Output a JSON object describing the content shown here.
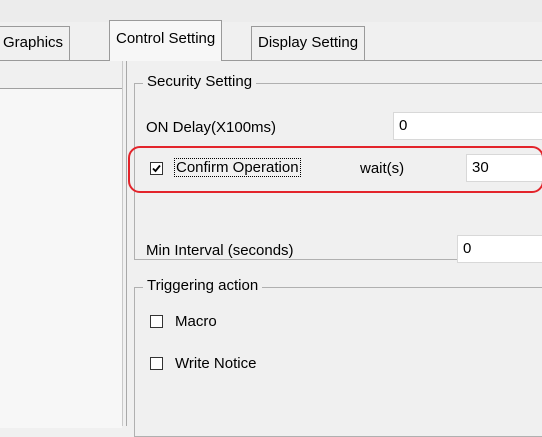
{
  "tabs": [
    {
      "label": "Graphics",
      "active": false
    },
    {
      "label": "Control Setting",
      "active": true
    },
    {
      "label": "Display Setting",
      "active": false
    }
  ],
  "security": {
    "title": "Security Setting",
    "on_delay_label": "ON Delay(X100ms)",
    "on_delay_value": "0",
    "confirm_label": "Confirm Operation",
    "confirm_checked": true,
    "wait_label": "wait(s)",
    "wait_value": "30",
    "min_interval_label": "Min Interval (seconds)",
    "min_interval_value": "0"
  },
  "triggering": {
    "title": "Triggering action",
    "macro_label": "Macro",
    "macro_checked": false,
    "write_notice_label": "Write Notice",
    "write_notice_checked": false
  },
  "colors": {
    "highlight": "#e3242b",
    "background": "#f0f0f0"
  }
}
